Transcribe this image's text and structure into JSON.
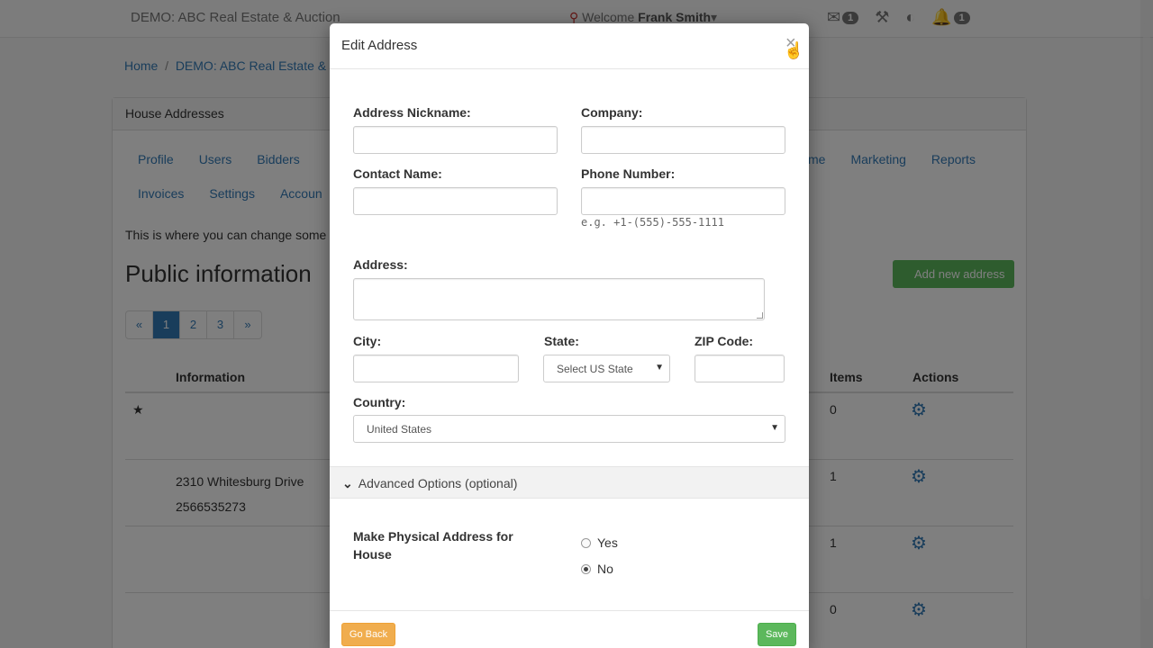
{
  "topbar": {
    "brand": "DEMO: ABC Real Estate & Auction",
    "welcome_prefix": "Welcome",
    "user_name": "Frank Smith",
    "mail_count": "1",
    "alert_count": "1"
  },
  "breadcrumb": {
    "home": "Home",
    "current": "DEMO: ABC Real Estate &"
  },
  "panel": {
    "title": "House Addresses",
    "nav_row1": [
      "Profile",
      "Users",
      "Bidders"
    ],
    "nav_row1_right": [
      "me",
      "Marketing",
      "Reports"
    ],
    "nav_row2": [
      "Invoices",
      "Settings",
      "Accoun"
    ],
    "intro": "This is where you can change some",
    "heading": "Public information",
    "add_button": "Add new address",
    "pager": [
      "«",
      "1",
      "2",
      "3",
      "»"
    ],
    "table": {
      "col_info": "Information",
      "col_items": "Items",
      "col_actions": "Actions",
      "rows": [
        {
          "info1": "",
          "info2": "",
          "items": "0"
        },
        {
          "info1": "2310 Whitesburg Drive",
          "info2": "2566535273",
          "items": "1"
        },
        {
          "info1": "",
          "info2": "",
          "items": "1"
        },
        {
          "info1": "",
          "info2": "",
          "items": "0"
        }
      ]
    }
  },
  "modal": {
    "title": "Edit Address",
    "close": "×",
    "fields": {
      "nickname_label": "Address Nickname:",
      "company_label": "Company:",
      "contact_label": "Contact Name:",
      "phone_label": "Phone Number:",
      "phone_help": "e.g. +1-(555)-555-1111",
      "address_label": "Address:",
      "city_label": "City:",
      "state_label": "State:",
      "state_value": "Select US State",
      "zip_label": "ZIP Code:",
      "country_label": "Country:",
      "country_value": "United States"
    },
    "advanced": "Advanced Options (optional)",
    "physical_label": "Make Physical Address for House",
    "radio_yes": "Yes",
    "radio_no": "No",
    "selected": "No",
    "go_back": "Go Back",
    "save": "Save"
  },
  "colors": {
    "primary": "#337ab7",
    "success": "#5cb85c",
    "warning": "#f0ad4e"
  }
}
